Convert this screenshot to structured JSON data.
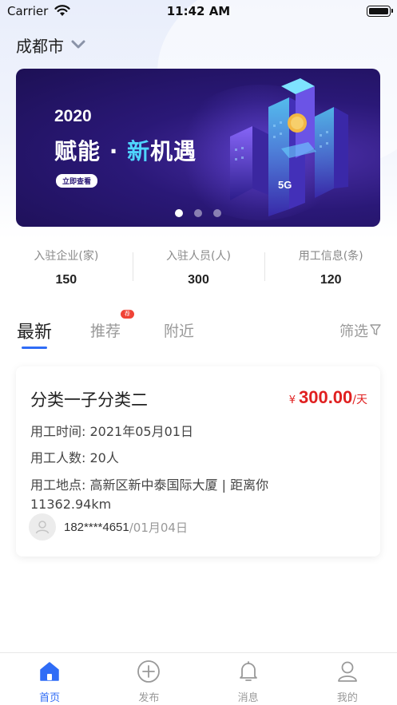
{
  "status_bar": {
    "carrier": "Carrier",
    "time": "11:42 AM",
    "icons": [
      "wifi-icon",
      "battery-icon"
    ]
  },
  "location": {
    "city": "成都市",
    "icon": "chevron-down-icon"
  },
  "banner": {
    "year": "2020",
    "headline_part1": "赋能 · ",
    "headline_part2": "新",
    "headline_part3": "机遇",
    "cta": "立即查看",
    "art_label": "5G",
    "slide_count": 3,
    "active_slide": 1
  },
  "stats": [
    {
      "label": "入驻企业(家)",
      "value": "150"
    },
    {
      "label": "入驻人员(人)",
      "value": "300"
    },
    {
      "label": "用工信息(条)",
      "value": "120"
    }
  ],
  "tabs": {
    "latest": "最新",
    "recommend": "推荐",
    "recommend_badge": "荐",
    "nearby": "附近",
    "filter": "筛选",
    "active": "latest"
  },
  "job": {
    "title": "分类一子分类二",
    "currency": "¥",
    "price": "300.00",
    "unit": "/天",
    "time_label": "用工时间:",
    "time_value": "2021年05月01日",
    "count_label": "用工人数:",
    "count_value": "20人",
    "location_label": "用工地点:",
    "location_value": "高新区新中泰国际大厦 | 距离你11362.94km",
    "poster_phone": "182****4651",
    "poster_date": "/01月04日"
  },
  "colors": {
    "primary": "#2f6cf6",
    "price": "#e02020",
    "banner_bg": "#2a1877",
    "badge": "#f04336"
  },
  "tabbar": [
    {
      "label": "首页",
      "icon": "home-icon",
      "active": true
    },
    {
      "label": "发布",
      "icon": "plus-circle-icon",
      "active": false
    },
    {
      "label": "消息",
      "icon": "bell-icon",
      "active": false
    },
    {
      "label": "我的",
      "icon": "user-icon",
      "active": false
    }
  ]
}
